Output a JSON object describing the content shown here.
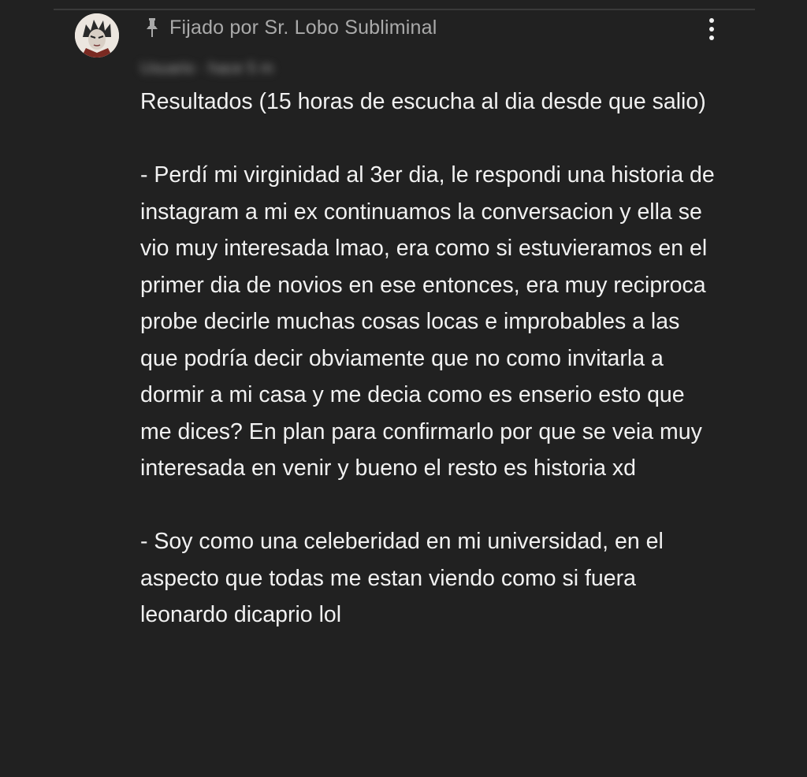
{
  "comment": {
    "pinned_label": "Fijado por Sr. Lobo Subliminal",
    "author_line": "Usuario · hace 5 m",
    "paragraphs": [
      "Resultados (15 horas de escucha al dia desde que salio)",
      "- Perdí mi virginidad al 3er dia, le respondi una historia de instagram a mi ex continuamos la conversacion y ella se vio muy interesada lmao, era como si estuvieramos en el primer dia de novios en ese entonces, era muy reciproca probe decirle muchas cosas locas e improbables a las que podría decir obviamente que no como invitarla a dormir a mi casa y me decia como es enserio esto que me dices? En plan para confirmarlo por que se veia muy interesada en venir y bueno el resto es historia xd",
      "- Soy como una celeberidad en mi universidad, en el aspecto que todas me estan viendo como si fuera leonardo dicaprio lol"
    ]
  },
  "icons": {
    "pin": "pin-icon",
    "menu": "more-vert-icon",
    "avatar": "avatar"
  },
  "colors": {
    "background": "#212121",
    "text": "#f1f1f1",
    "secondary_text": "#aaaaaa"
  }
}
